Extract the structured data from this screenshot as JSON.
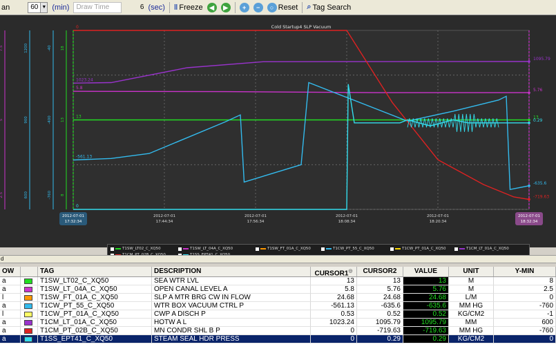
{
  "toolbar": {
    "left_cut": "an",
    "span_value": "60",
    "span_unit": "(min)",
    "draw_time_label": "Draw Time",
    "draw_value": "6",
    "draw_unit": "(sec)",
    "freeze_label": "Freeze",
    "reset_label": "Reset",
    "tag_search_label": "Tag Search"
  },
  "chart_data": {
    "type": "line",
    "title": "Cold Startup4 SLP Vacuum",
    "x_start": "2012-07-01 17:32:34",
    "x_end": "2012-07-01 18:32:34",
    "x_ticks": [
      {
        "date": "2012-07-01",
        "time": "17:32:34"
      },
      {
        "date": "2012-07-01",
        "time": "17:44:34"
      },
      {
        "date": "2012-07-01",
        "time": "17:56:34"
      },
      {
        "date": "2012-07-01",
        "time": "18:08:34"
      },
      {
        "date": "2012-07-01",
        "time": "18:20:34"
      },
      {
        "date": "2012-07-01",
        "time": "18:32:34"
      }
    ],
    "series": [
      {
        "name": "T1SW_LT02_C_XQ50",
        "color": "#22dd22",
        "y_min": 8,
        "y_max": 18,
        "left_label": "13",
        "right_label": "13",
        "points": [
          [
            0,
            13
          ],
          [
            60,
            13
          ]
        ]
      },
      {
        "name": "T1SW_LT_04A_C_XQ50",
        "color": "#cc33cc",
        "y_min": 2.5,
        "y_max": 7.5,
        "left_label": "5.8",
        "right_label": "5.76",
        "points": [
          [
            0,
            5.8
          ],
          [
            20,
            5.79
          ],
          [
            40,
            5.76
          ],
          [
            60,
            5.76
          ]
        ]
      },
      {
        "name": "T1SW_FT_01A_C_XQ50",
        "color": "#ff9900",
        "y_min": 0,
        "y_max": 50,
        "left_label": "",
        "right_label": "",
        "points": []
      },
      {
        "name": "T1CW_PT_55_C_XQ50",
        "color": "#33bbee",
        "y_min": -760,
        "y_max": -40,
        "left_label": "-561.13",
        "right_label": "-635.6",
        "points": [
          [
            0,
            -561.13
          ],
          [
            5,
            -555
          ],
          [
            10,
            -535
          ],
          [
            20,
            -408
          ],
          [
            22,
            -380
          ],
          [
            22.5,
            -650
          ],
          [
            30,
            -580
          ],
          [
            31,
            -250
          ],
          [
            44,
            -405
          ],
          [
            50,
            -365
          ],
          [
            56,
            -320
          ],
          [
            57,
            -305
          ],
          [
            57.5,
            -680
          ],
          [
            60,
            -665
          ]
        ]
      },
      {
        "name": "T1CW_PT_01A_C_XQ50",
        "color": "#ffdd00",
        "y_min": -1,
        "y_max": 1.5,
        "left_label": "",
        "right_label": "",
        "points": []
      },
      {
        "name": "T1CM_LT_01A_C_XQ50",
        "color": "#9933cc",
        "y_min": 600,
        "y_max": 1200,
        "left_label": "1023.24",
        "right_label": "1095.79",
        "points": [
          [
            0,
            1023.24
          ],
          [
            5,
            1025
          ],
          [
            15,
            1075
          ],
          [
            25,
            1095
          ],
          [
            60,
            1095.79
          ]
        ]
      },
      {
        "name": "T1CM_PT_02B_C_XQ50",
        "color": "#dd2222",
        "y_min": -760,
        "y_max": -40,
        "left_label": "0",
        "right_label": "-719.63",
        "points": [
          [
            0,
            -40
          ],
          [
            36,
            -40
          ],
          [
            42,
            -330
          ],
          [
            48,
            -560
          ],
          [
            54,
            -660
          ],
          [
            58,
            -710
          ],
          [
            60,
            -719.63
          ]
        ]
      },
      {
        "name": "T1SS_EPT41_C_XQ50",
        "color": "#33ddee",
        "y_min": 0,
        "y_max": 0.6,
        "left_label": "0",
        "right_label": "0.29",
        "points": [
          [
            0,
            0
          ],
          [
            36,
            0
          ],
          [
            36.2,
            0.42
          ],
          [
            37,
            0.29
          ],
          [
            43,
            0.29
          ],
          [
            44,
            0.3
          ],
          [
            47,
            0.28
          ],
          [
            50,
            0.3
          ],
          [
            52,
            0.29
          ],
          [
            56,
            0.29
          ],
          [
            60,
            0.29
          ]
        ]
      }
    ],
    "axis_ticks": [
      {
        "color": "#cc33cc",
        "values": [
          "7.5",
          "5",
          "2.5"
        ]
      },
      {
        "color": "#33bbee",
        "values": [
          "1200",
          "900",
          "600"
        ]
      },
      {
        "color": "#33bbee",
        "values": [
          "-40",
          "-400",
          "-760"
        ]
      },
      {
        "color": "#22dd22",
        "values": [
          "18",
          "13",
          "8"
        ]
      }
    ]
  },
  "panel_bar_label": "d",
  "table": {
    "headers": {
      "row": "OW",
      "color": "",
      "tag": "TAG",
      "description": "DESCRIPTION",
      "cursor1": "CURSOR1",
      "cursor2": "CURSOR2",
      "value": "VALUE",
      "unit": "UNIT",
      "ymin": "Y-MIN"
    },
    "rows": [
      {
        "row": "a",
        "color": "#22dd22",
        "tag": "T1SW_LT02_C_XQ50",
        "description": "SEA WTR LVL",
        "cursor1": "13",
        "cursor2": "13",
        "value": "13",
        "unit": "M",
        "ymin": "8"
      },
      {
        "row": "a",
        "color": "#cc33cc",
        "tag": "T1SW_LT_04A_C_XQ50",
        "description": "OPEN CANAL LEVEL A",
        "cursor1": "5.8",
        "cursor2": "5.76",
        "value": "5.76",
        "unit": "M",
        "ymin": "2.5"
      },
      {
        "row": "l",
        "color": "#ff9900",
        "tag": "T1SW_FT_01A_C_XQ50",
        "description": "SLP A MTR BRG CW IN FLOW",
        "cursor1": "24.68",
        "cursor2": "24.68",
        "value": "24.68",
        "unit": "L/M",
        "ymin": "0"
      },
      {
        "row": "a",
        "color": "#33bbee",
        "tag": "T1CW_PT_55_C_XQ50",
        "description": "WTR BOX VACUUM CTRL P",
        "cursor1": "-561.13",
        "cursor2": "-635.6",
        "value": "-635.6",
        "unit": "MM HG",
        "ymin": "-760"
      },
      {
        "row": "l",
        "color": "#ffff66",
        "tag": "T1CW_PT_01A_C_XQ50",
        "description": "CWP A DISCH P",
        "cursor1": "0.53",
        "cursor2": "0.52",
        "value": "0.52",
        "unit": "KG/CM2",
        "ymin": "-1"
      },
      {
        "row": "a",
        "color": "#9933cc",
        "tag": "T1CM_LT_01A_C_XQ50",
        "description": "HOTW A L",
        "cursor1": "1023.24",
        "cursor2": "1095.79",
        "value": "1095.79",
        "unit": "MM",
        "ymin": "600"
      },
      {
        "row": "a",
        "color": "#dd2222",
        "tag": "T1CM_PT_02B_C_XQ50",
        "description": "MN CONDR SHL B P",
        "cursor1": "0",
        "cursor2": "-719.63",
        "value": "-719.63",
        "unit": "MM HG",
        "ymin": "-760"
      },
      {
        "row": "a",
        "color": "#33ddee",
        "tag": "T1SS_EPT41_C_XQ50",
        "description": "STEAM SEAL HDR PRESS",
        "cursor1": "0",
        "cursor2": "0.29",
        "value": "0.29",
        "unit": "KG/CM2",
        "ymin": "0"
      }
    ]
  }
}
